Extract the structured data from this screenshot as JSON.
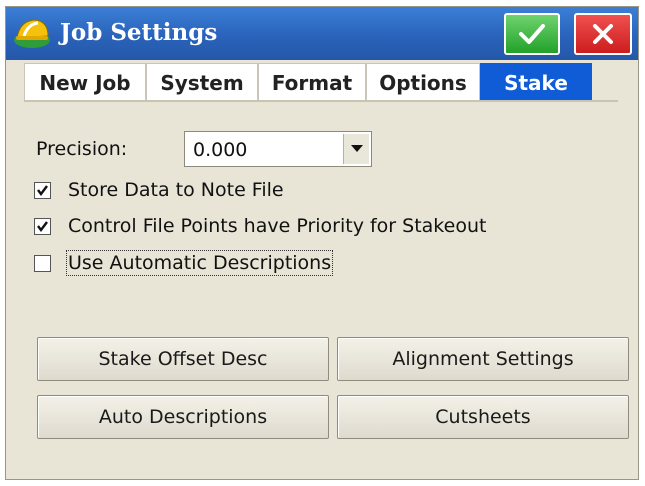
{
  "window": {
    "title": "Job Settings"
  },
  "tabs": [
    {
      "label": "New Job",
      "active": false
    },
    {
      "label": "System",
      "active": false
    },
    {
      "label": "Format",
      "active": false
    },
    {
      "label": "Options",
      "active": false
    },
    {
      "label": "Stake",
      "active": true
    }
  ],
  "precision": {
    "label": "Precision:",
    "value": "0.000"
  },
  "checkboxes": [
    {
      "label": "Store Data to Note File",
      "checked": true
    },
    {
      "label": "Control File Points have Priority for Stakeout",
      "checked": true
    },
    {
      "label": "Use Automatic Descriptions",
      "checked": false
    }
  ],
  "buttons": {
    "stake_offset_desc": "Stake Offset Desc",
    "alignment_settings": "Alignment Settings",
    "auto_descriptions": "Auto Descriptions",
    "cutsheets": "Cutsheets"
  },
  "colors": {
    "titlebar": "#2a63bb",
    "active_tab": "#0f5cd6",
    "ok": "#22a12a",
    "cancel": "#cc1d1d",
    "panel": "#e8e4d6"
  },
  "icons": {
    "app": "hardhat-icon",
    "ok": "check-icon",
    "cancel": "close-icon"
  }
}
